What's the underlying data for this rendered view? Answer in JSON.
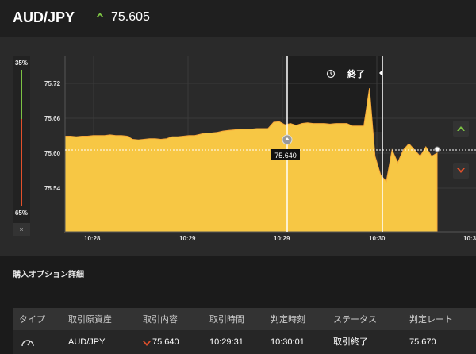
{
  "header": {
    "pair": "AUD/JPY",
    "price": "75.605",
    "price_direction": "up-arrow-icon",
    "accent_up": "#7bc143",
    "accent_down": "#e2502b"
  },
  "meter": {
    "top_pct": "35%",
    "bottom_pct": "65%",
    "close_label": "×"
  },
  "chart": {
    "y_ticks": [
      "75.72",
      "75.66",
      "75.60",
      "75.54"
    ],
    "x_ticks": [
      "10:28",
      "10:29",
      "10:29",
      "10:30",
      "10:3"
    ],
    "entry_label": "75.640",
    "end_label": "終了",
    "fill_color": "#f7c744"
  },
  "chart_data": {
    "type": "area",
    "title": "",
    "xlabel": "",
    "ylabel": "",
    "ylim": [
      75.48,
      75.76
    ],
    "x_ticks": [
      "10:28",
      "10:29",
      "10:29",
      "10:30",
      "10:3"
    ],
    "series": [
      {
        "values": [
          75.632,
          75.632,
          75.631,
          75.632,
          75.632,
          75.633,
          75.633,
          75.633,
          75.634,
          75.633,
          75.633,
          75.632,
          75.627,
          75.626,
          75.627,
          75.628,
          75.628,
          75.627,
          75.628,
          75.631,
          75.631,
          75.632,
          75.633,
          75.633,
          75.635,
          75.637,
          75.637,
          75.638,
          75.64,
          75.641,
          75.642,
          75.643,
          75.643,
          75.643,
          75.644,
          75.644,
          75.644,
          75.654,
          75.655,
          75.65,
          75.652,
          75.649,
          75.652,
          75.653,
          75.652,
          75.652,
          75.652,
          75.651,
          75.652,
          75.652,
          75.652,
          75.648,
          75.648,
          75.648,
          75.708,
          75.6,
          75.57,
          75.56,
          75.61,
          75.59,
          75.61,
          75.62,
          75.61,
          75.6,
          75.615,
          75.6,
          75.605
        ]
      }
    ]
  },
  "section": {
    "title": "購入オプション詳細"
  },
  "table": {
    "headers": [
      "タイプ",
      "取引原資産",
      "取引内容",
      "取引時間",
      "判定時刻",
      "ステータス",
      "判定レート"
    ],
    "row": {
      "type_icon": "gauge-icon",
      "asset": "AUD/JPY",
      "direction_icon": "down-arrow-icon",
      "content": "75.640",
      "trade_time": "10:29:31",
      "judge_time": "10:30:01",
      "status": "取引終了",
      "rate": "75.670"
    }
  }
}
